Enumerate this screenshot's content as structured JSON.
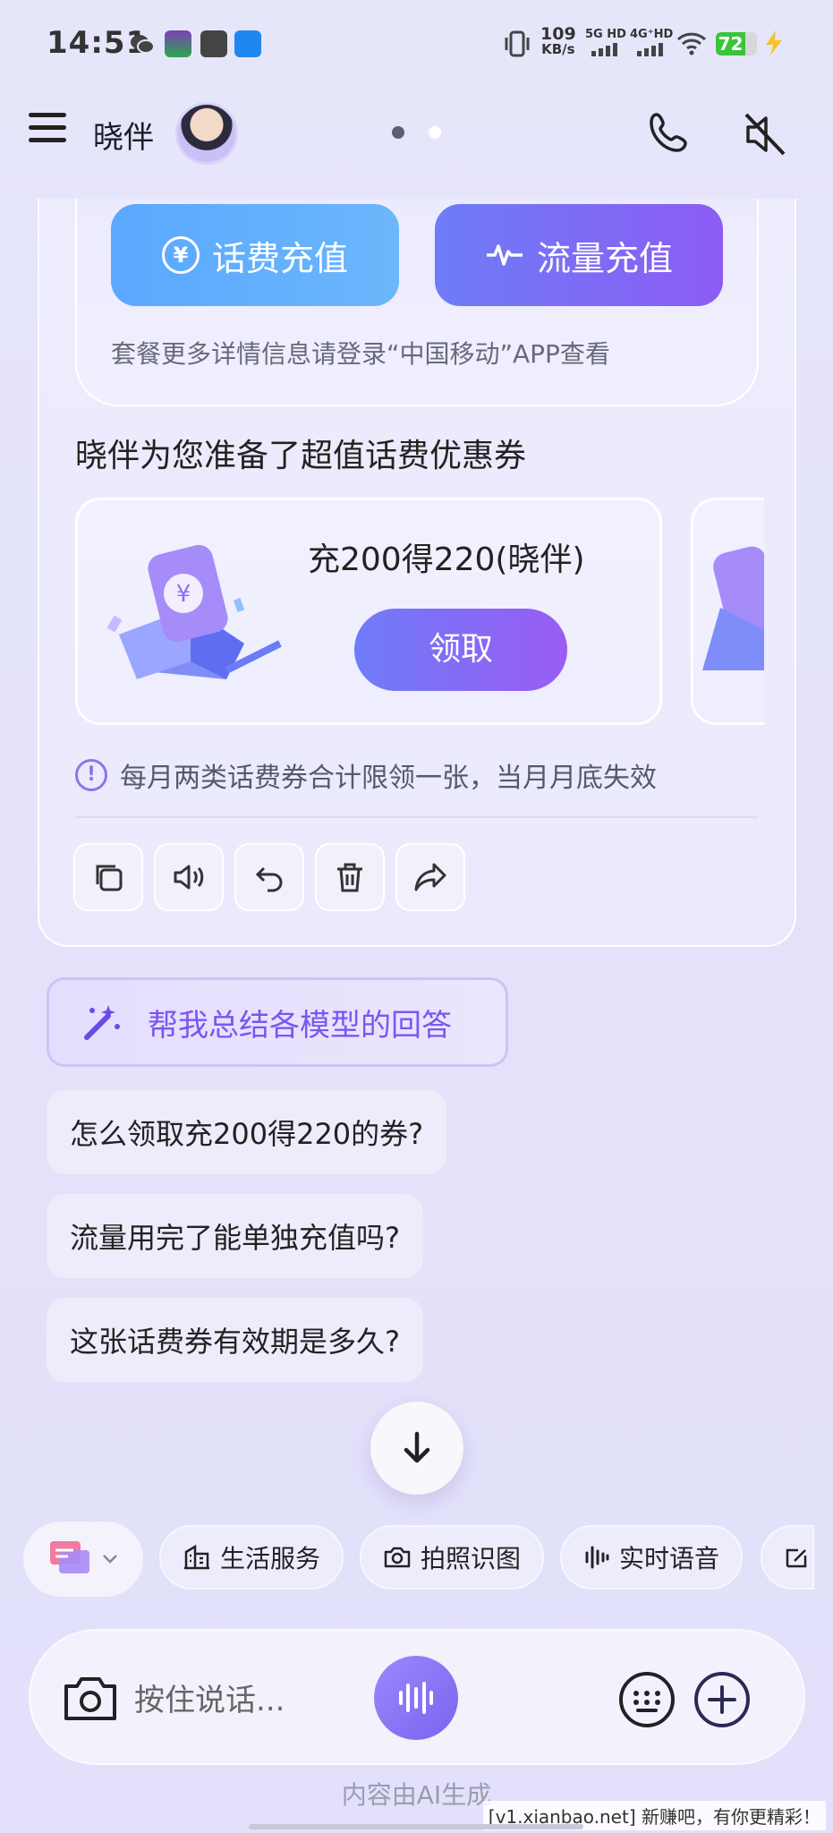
{
  "status_bar": {
    "time": "14:51",
    "speed_value": "109",
    "speed_unit": "KB/s",
    "sim1": "5G HD",
    "sim2": "4G⁺HD",
    "battery": "72",
    "battery_level": 0.72
  },
  "header": {
    "title": "晓伴",
    "page_dots": [
      {
        "active": true
      },
      {
        "active": false
      }
    ],
    "icons": [
      "menu-icon",
      "phone-icon",
      "speaker-mute-icon"
    ]
  },
  "recharge": {
    "phone_label": "话费充值",
    "data_label": "流量充值",
    "note": "套餐更多详情信息请登录“中国移动”APP查看"
  },
  "coupons": {
    "title": "晓伴为您准备了超值话费优惠券",
    "items": [
      {
        "name": "充200得220(晓伴)",
        "button": "领取"
      }
    ],
    "limit_note": "每月两类话费券合计限领一张，当月月底失效"
  },
  "actions": [
    "copy-icon",
    "speaker-icon",
    "undo-icon",
    "delete-icon",
    "share-icon"
  ],
  "suggestions": {
    "summary": "帮我总结各模型的回答",
    "questions": [
      "怎么领取充200得220的券?",
      "流量用完了能单独充值吗?",
      "这张话费券有效期是多久?"
    ]
  },
  "tools": [
    {
      "label": "生活服务",
      "icon": "building-icon"
    },
    {
      "label": "拍照识图",
      "icon": "camera-icon"
    },
    {
      "label": "实时语音",
      "icon": "waveform-icon"
    }
  ],
  "input": {
    "placeholder": "按住说话..."
  },
  "footer": {
    "ai_note": "内容由AI生成",
    "watermark": "[v1.xianbao.net] 新赚吧，有你更精彩！"
  },
  "colors": {
    "accent": "#7b55f2",
    "blue_button": "#5aa8ff",
    "purple_button": "#8c5cf4",
    "battery": "#3ac43a"
  }
}
